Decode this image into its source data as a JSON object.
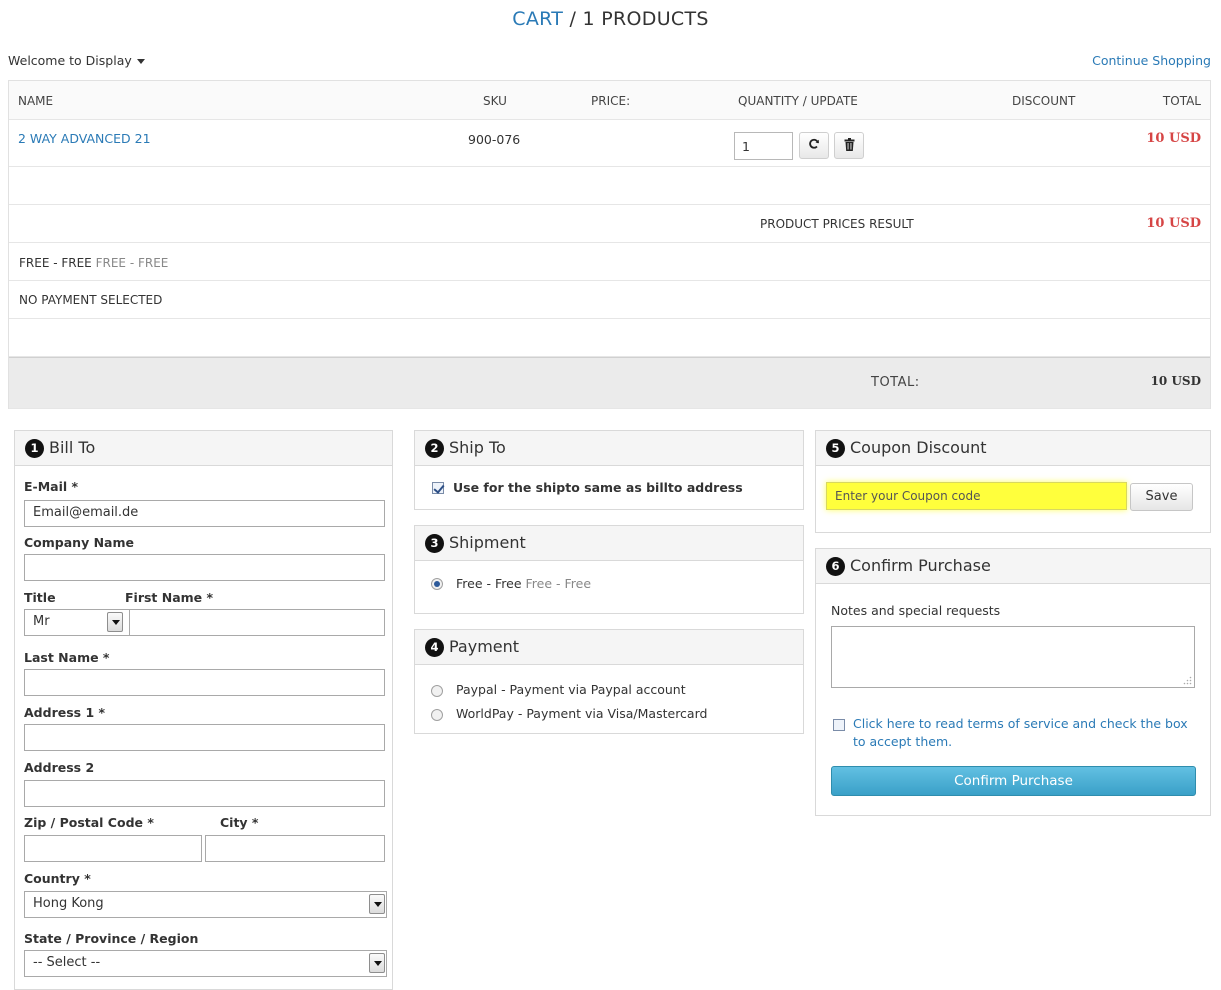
{
  "header": {
    "cart_word": "CART",
    "products_count": "/ 1 PRODUCTS",
    "welcome": "Welcome to Display",
    "continue": "Continue Shopping"
  },
  "table": {
    "headers": {
      "name": "NAME",
      "sku": "SKU",
      "price": "PRICE:",
      "qty": "QUANTITY / UPDATE",
      "discount": "DISCOUNT",
      "total": "TOTAL"
    },
    "item": {
      "name": "2 WAY ADVANCED 21",
      "sku": "900-076",
      "quantity": "1",
      "total": "10 USD"
    },
    "product_prices_label": "PRODUCT PRICES RESULT",
    "product_prices_value": "10 USD",
    "shipment_main": "FREE - FREE",
    "shipment_sub": "FREE - FREE",
    "payment": "NO PAYMENT SELECTED",
    "total_label": "TOTAL:",
    "total_value": "10 USD"
  },
  "bill_to": {
    "number": "1",
    "title": "Bill To",
    "email_label": "E-Mail *",
    "email_value": "Email@email.de",
    "company_label": "Company Name",
    "title_label": "Title",
    "title_value": "Mr",
    "first_name_label": "First Name *",
    "last_name_label": "Last Name *",
    "address1_label": "Address 1 *",
    "address2_label": "Address 2",
    "zip_label": "Zip / Postal Code *",
    "city_label": "City *",
    "country_label": "Country *",
    "country_value": "Hong Kong",
    "state_label": "State / Province / Region",
    "state_value": "-- Select --"
  },
  "ship_to": {
    "number": "2",
    "title": "Ship To",
    "same_label": "Use for the shipto same as billto address"
  },
  "shipment": {
    "number": "3",
    "title": "Shipment",
    "option_main": "Free - Free",
    "option_sub": "Free - Free"
  },
  "payment": {
    "number": "4",
    "title": "Payment",
    "options": [
      "Paypal - Payment via Paypal account",
      "WorldPay - Payment via Visa/Mastercard"
    ]
  },
  "coupon": {
    "number": "5",
    "title": "Coupon Discount",
    "placeholder": "Enter your Coupon code",
    "save": "Save"
  },
  "confirm": {
    "number": "6",
    "title": "Confirm Purchase",
    "notes_label": "Notes and special requests",
    "terms": "Click here to read terms of service and check the box to accept them.",
    "button": "Confirm Purchase"
  },
  "colors": {
    "link": "#2a7ab6",
    "price_red": "#d64545",
    "coupon_highlight": "#ffff3c",
    "confirm_button": "#45a8cf"
  }
}
